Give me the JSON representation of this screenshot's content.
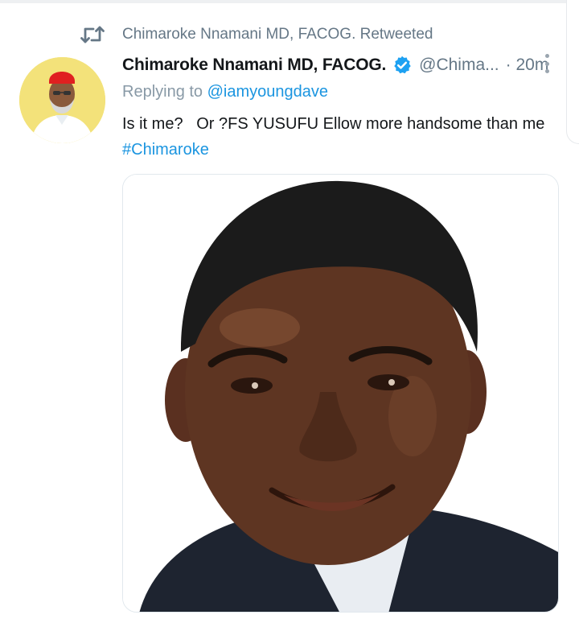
{
  "colors": {
    "link": "#1b95e0",
    "secondary_text": "#657786",
    "verified": "#1da1f2",
    "avatar_bg": "#f3e27a",
    "cap": "#e02020"
  },
  "icons": {
    "retweet": "retweet-icon",
    "verified": "verified-badge-icon",
    "more": "more-vertical-icon"
  },
  "retweet_banner": {
    "label": "Chimaroke Nnamani MD, FACOG. Retweeted"
  },
  "tweet": {
    "author": {
      "display_name": "Chimaroke Nnamani MD, FACOG.",
      "handle": "@Chima...",
      "verified": true
    },
    "timestamp": "· 20m",
    "replying_to": {
      "prefix": "Replying to ",
      "mention": "@iamyoungdave"
    },
    "text": "Is it me?   Or ?FS YUSUFU Ellow more handsome than me",
    "hashtag": "#Chimaroke"
  }
}
